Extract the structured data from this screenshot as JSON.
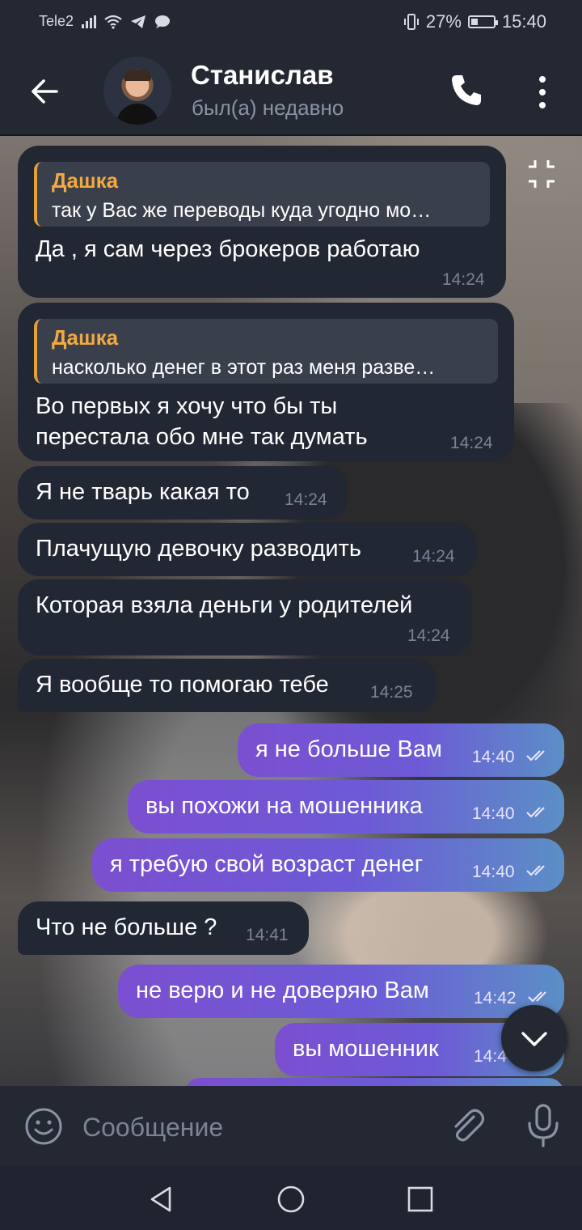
{
  "status_bar": {
    "carrier": "Tele2",
    "battery": "27%",
    "time": "15:40"
  },
  "header": {
    "contact_name": "Станислав",
    "contact_status": "был(а) недавно"
  },
  "messages": [
    {
      "dir": "in",
      "reply_name": "Дашка",
      "reply_text": "так у Вас же переводы куда угодно мо…",
      "text": "Да , я сам через брокеров работаю",
      "time": "14:24"
    },
    {
      "dir": "in",
      "reply_name": "Дашка",
      "reply_text": "насколько денег в этот раз меня разве…",
      "text_line1": "Во первых я хочу что бы ты",
      "text_line2": "перестала обо мне так думать",
      "time": "14:24"
    },
    {
      "dir": "in",
      "text": "Я не тварь какая то",
      "time": "14:24"
    },
    {
      "dir": "in",
      "text": "Плачущую девочку разводить",
      "time": "14:24"
    },
    {
      "dir": "in",
      "text": "Которая взяла деньги у родителей",
      "time": "14:24"
    },
    {
      "dir": "in",
      "text": "Я вообще то помогаю тебе",
      "time": "14:25"
    },
    {
      "dir": "out",
      "text": "я не больше Вам",
      "time": "14:40"
    },
    {
      "dir": "out",
      "text": "вы похожи на мошенника",
      "time": "14:40"
    },
    {
      "dir": "out",
      "text": "я требую свой возраст денег",
      "time": "14:40"
    },
    {
      "dir": "in",
      "text": "Что не больше ?",
      "time": "14:41"
    },
    {
      "dir": "out",
      "text": "не верю и не доверяю Вам",
      "time": "14:42"
    },
    {
      "dir": "out",
      "text": "вы мошенник",
      "time": "14:4"
    }
  ],
  "input": {
    "placeholder": "Сообщение"
  },
  "colors": {
    "incoming_bubble": "#222734",
    "outgoing_gradient_start": "#7b4fd0",
    "outgoing_gradient_end": "#5b8fc6",
    "reply_accent": "#f2a940"
  },
  "icons": [
    "back-arrow-icon",
    "phone-icon",
    "more-vert-icon",
    "collapse-icon",
    "double-check-icon",
    "chevron-down-icon",
    "emoji-icon",
    "attach-icon",
    "mic-icon",
    "nav-back-icon",
    "nav-home-icon",
    "nav-recents-icon"
  ]
}
